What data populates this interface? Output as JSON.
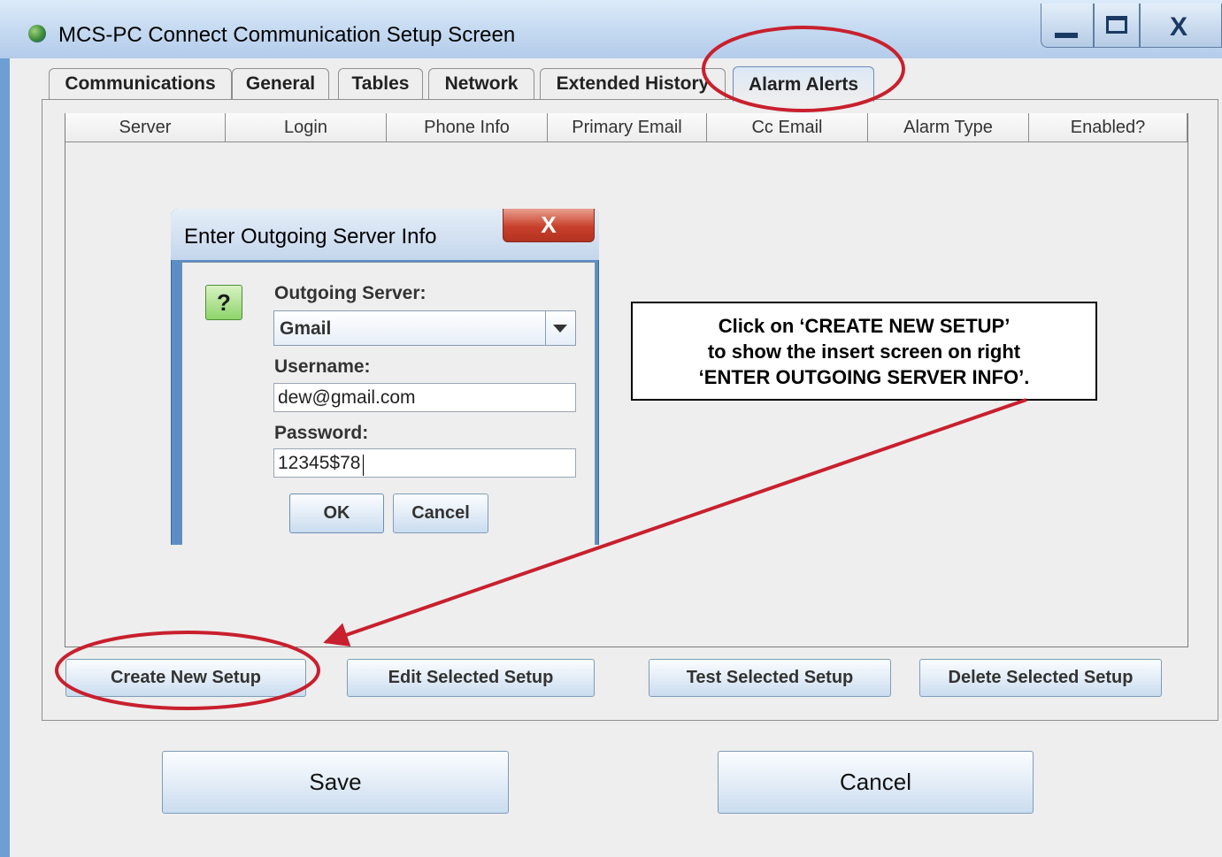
{
  "window": {
    "title": "MCS-PC Connect Communication Setup Screen",
    "close_glyph": "X"
  },
  "tabs": [
    {
      "label": "Communications"
    },
    {
      "label": "General"
    },
    {
      "label": "Tables"
    },
    {
      "label": "Network"
    },
    {
      "label": "Extended History"
    },
    {
      "label": "Alarm Alerts",
      "selected": true
    }
  ],
  "table": {
    "columns": [
      "Server",
      "Login",
      "Phone Info",
      "Primary Email",
      "Cc Email",
      "Alarm Type",
      "Enabled?"
    ],
    "rows": []
  },
  "actions": {
    "create": "Create New Setup",
    "edit": "Edit Selected Setup",
    "test": "Test Selected Setup",
    "delete": "Delete Selected Setup"
  },
  "footer": {
    "save": "Save",
    "cancel": "Cancel"
  },
  "dialog": {
    "title": "Enter Outgoing Server Info",
    "close_glyph": "X",
    "icon_glyph": "?",
    "server_label": "Outgoing Server:",
    "server_value": "Gmail",
    "username_label": "Username:",
    "username_value": "dew@gmail.com",
    "password_label": "Password:",
    "password_value": "12345$78",
    "ok": "OK",
    "cancel": "Cancel"
  },
  "callout": {
    "lines": [
      "Click on ‘CREATE NEW SETUP’",
      "to show the insert screen on right",
      "‘ENTER OUTGOING SERVER INFO’."
    ]
  },
  "colors": {
    "annotation_red": "#c8202e",
    "frame_blue": "#6d9fd2"
  }
}
